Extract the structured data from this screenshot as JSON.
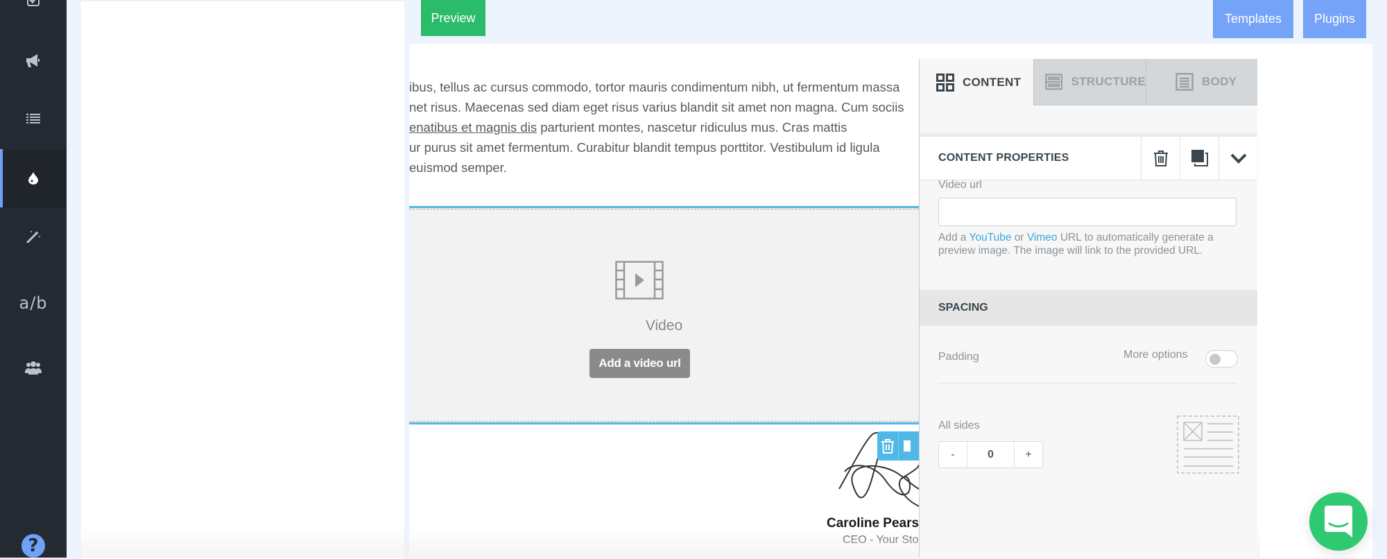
{
  "sidebar": {
    "items": [
      {
        "icon": "checkbox-icon",
        "active": false
      },
      {
        "icon": "megaphone-icon",
        "active": false
      },
      {
        "icon": "list-icon",
        "active": false
      },
      {
        "icon": "droplet-icon",
        "active": true
      },
      {
        "icon": "magic-wand-icon",
        "active": false
      },
      {
        "icon": "ab-test-icon",
        "label": "a/b",
        "active": false
      },
      {
        "icon": "users-icon",
        "active": false
      }
    ],
    "help_label": "?"
  },
  "topbar": {
    "preview_label": "Preview",
    "templates_label": "Templates",
    "plugins_label": "Plugins"
  },
  "canvas": {
    "paragraph_lines": [
      "ibus, tellus ac cursus commodo, tortor mauris condimentum nibh, ut fermentum massa",
      "net risus. Maecenas sed diam eget risus varius blandit sit amet non magna. Cum sociis",
      "parturient montes, nascetur ridiculus mus. Cras mattis",
      "ur purus sit amet fermentum. Curabitur blandit tempus porttitor. Vestibulum id ligula",
      " euismod semper."
    ],
    "paragraph_link": "enatibus et magnis dis",
    "video_block": {
      "label": "Video",
      "button_label": "Add a video url"
    },
    "signature": {
      "name": "Caroline Pearsc",
      "role": "CEO - Your Stor"
    }
  },
  "properties_panel": {
    "tabs": [
      {
        "label": "CONTENT",
        "icon": "grid-icon",
        "active": true
      },
      {
        "label": "STRUCTURE",
        "icon": "rows-icon",
        "active": false
      },
      {
        "label": "BODY",
        "icon": "document-icon",
        "active": false
      }
    ],
    "header_title": "CONTENT PROPERTIES",
    "video_url": {
      "label": "Video url",
      "value": "",
      "hint_prefix": "Add a ",
      "hint_link_1": "YouTube",
      "hint_mid": " or ",
      "hint_link_2": "Vimeo",
      "hint_suffix": " URL to automatically generate a preview image. The image will link to the provided URL."
    },
    "spacing": {
      "section_title": "SPACING",
      "padding_label": "Padding",
      "more_options_label": "More options",
      "more_options_enabled": false,
      "all_sides_label": "All sides",
      "decrement_label": "-",
      "value": "0",
      "increment_label": "+"
    }
  },
  "colors": {
    "sidebar_bg": "#242a31",
    "accent_blue": "#6fa1f6",
    "preview_green": "#2bbc6b",
    "button_blue": "#74a3f7",
    "selection_blue": "#50b8e6",
    "link_blue": "#3aa5e0",
    "chat_green": "#2ec971"
  }
}
